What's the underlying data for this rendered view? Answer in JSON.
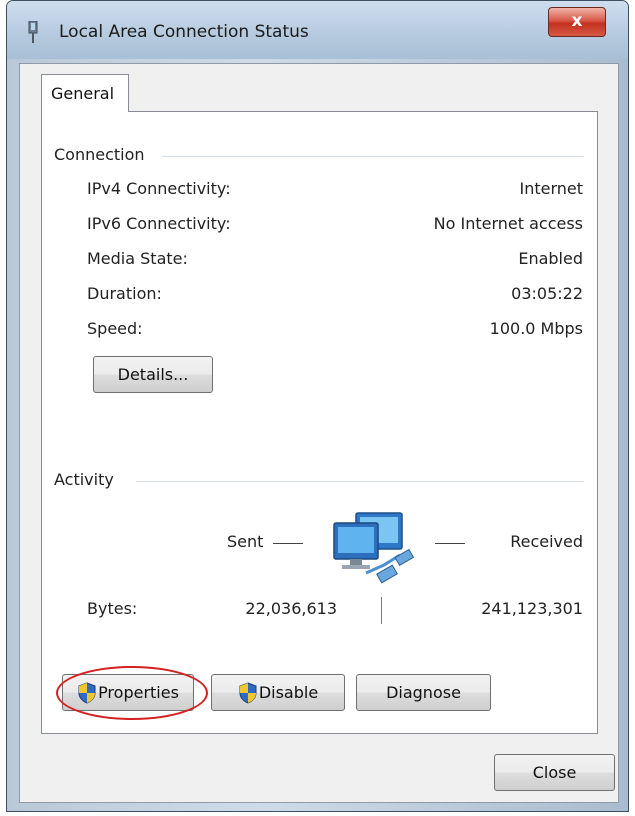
{
  "window": {
    "title": "Local Area Connection Status",
    "close_glyph": "x"
  },
  "tabs": [
    {
      "label": "General",
      "selected": true
    }
  ],
  "connection": {
    "header": "Connection",
    "rows": [
      {
        "label": "IPv4 Connectivity:",
        "value": "Internet"
      },
      {
        "label": "IPv6 Connectivity:",
        "value": "No Internet access"
      },
      {
        "label": "Media State:",
        "value": "Enabled"
      },
      {
        "label": "Duration:",
        "value": "03:05:22"
      },
      {
        "label": "Speed:",
        "value": "100.0 Mbps"
      }
    ],
    "details_button": "Details..."
  },
  "activity": {
    "header": "Activity",
    "sent_label": "Sent",
    "received_label": "Received",
    "bytes_label": "Bytes:",
    "bytes_sent": "22,036,613",
    "bytes_received": "241,123,301",
    "icon": "network-computers-icon"
  },
  "actions": {
    "properties_label": "Properties",
    "disable_label": "Disable",
    "diagnose_label": "Diagnose",
    "highlighted": "properties"
  },
  "footer": {
    "close_label": "Close"
  },
  "colors": {
    "highlight": "#d42020",
    "title_bar": "#b7cbe0",
    "close_button": "#c3301e"
  }
}
